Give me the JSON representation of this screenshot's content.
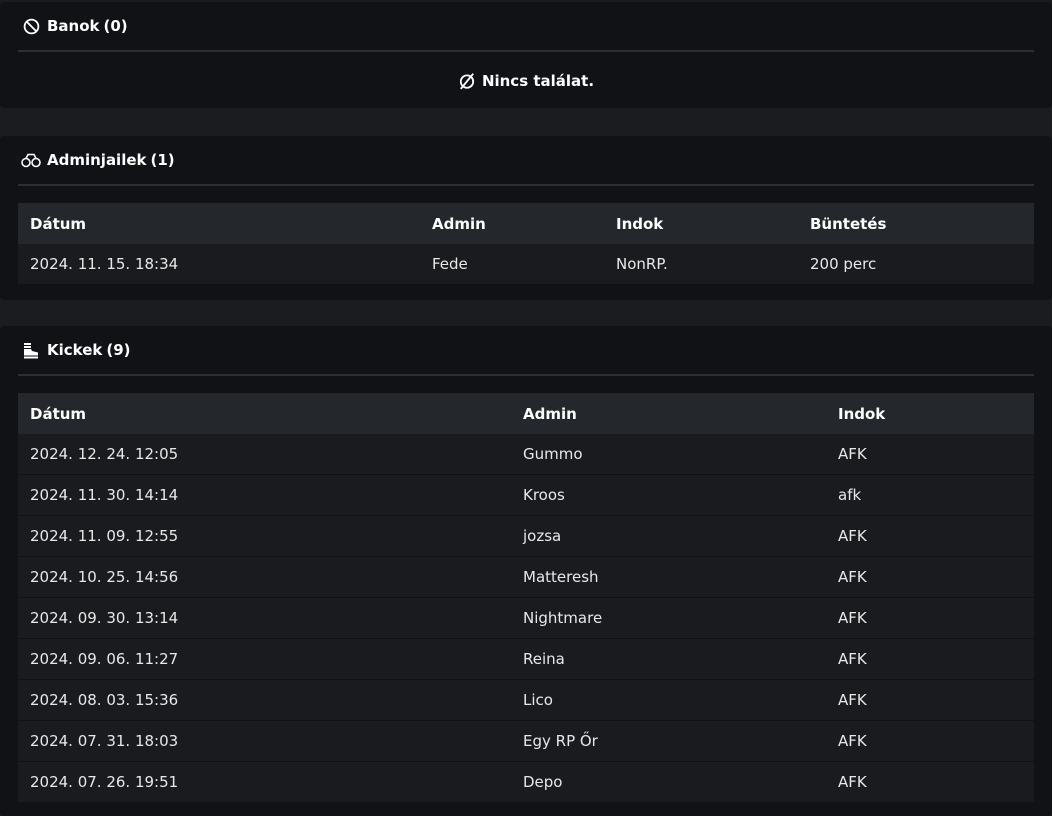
{
  "bans": {
    "title": "Banok",
    "count": "(0)",
    "empty_text": "Nincs találat."
  },
  "adminjails": {
    "title": "Adminjailek",
    "count": "(1)",
    "columns": [
      "Dátum",
      "Admin",
      "Indok",
      "Büntetés"
    ],
    "rows": [
      [
        "2024. 11. 15. 18:34",
        "Fede",
        "NonRP.",
        "200 perc"
      ]
    ]
  },
  "kicks": {
    "title": "Kickek",
    "count": "(9)",
    "columns": [
      "Dátum",
      "Admin",
      "Indok"
    ],
    "rows": [
      [
        "2024. 12. 24. 12:05",
        "Gummo",
        "AFK"
      ],
      [
        "2024. 11. 30. 14:14",
        "Kroos",
        "afk"
      ],
      [
        "2024. 11. 09. 12:55",
        "jozsa",
        "AFK"
      ],
      [
        "2024. 10. 25. 14:56",
        "Matteresh",
        "AFK"
      ],
      [
        "2024. 09. 30. 13:14",
        "Nightmare",
        "AFK"
      ],
      [
        "2024. 09. 06. 11:27",
        "Reina",
        "AFK"
      ],
      [
        "2024. 08. 03. 15:36",
        "Lico",
        "AFK"
      ],
      [
        "2024. 07. 31. 18:03",
        "Egy RP Őr",
        "AFK"
      ],
      [
        "2024. 07. 26. 19:51",
        "Depo",
        "AFK"
      ]
    ]
  }
}
